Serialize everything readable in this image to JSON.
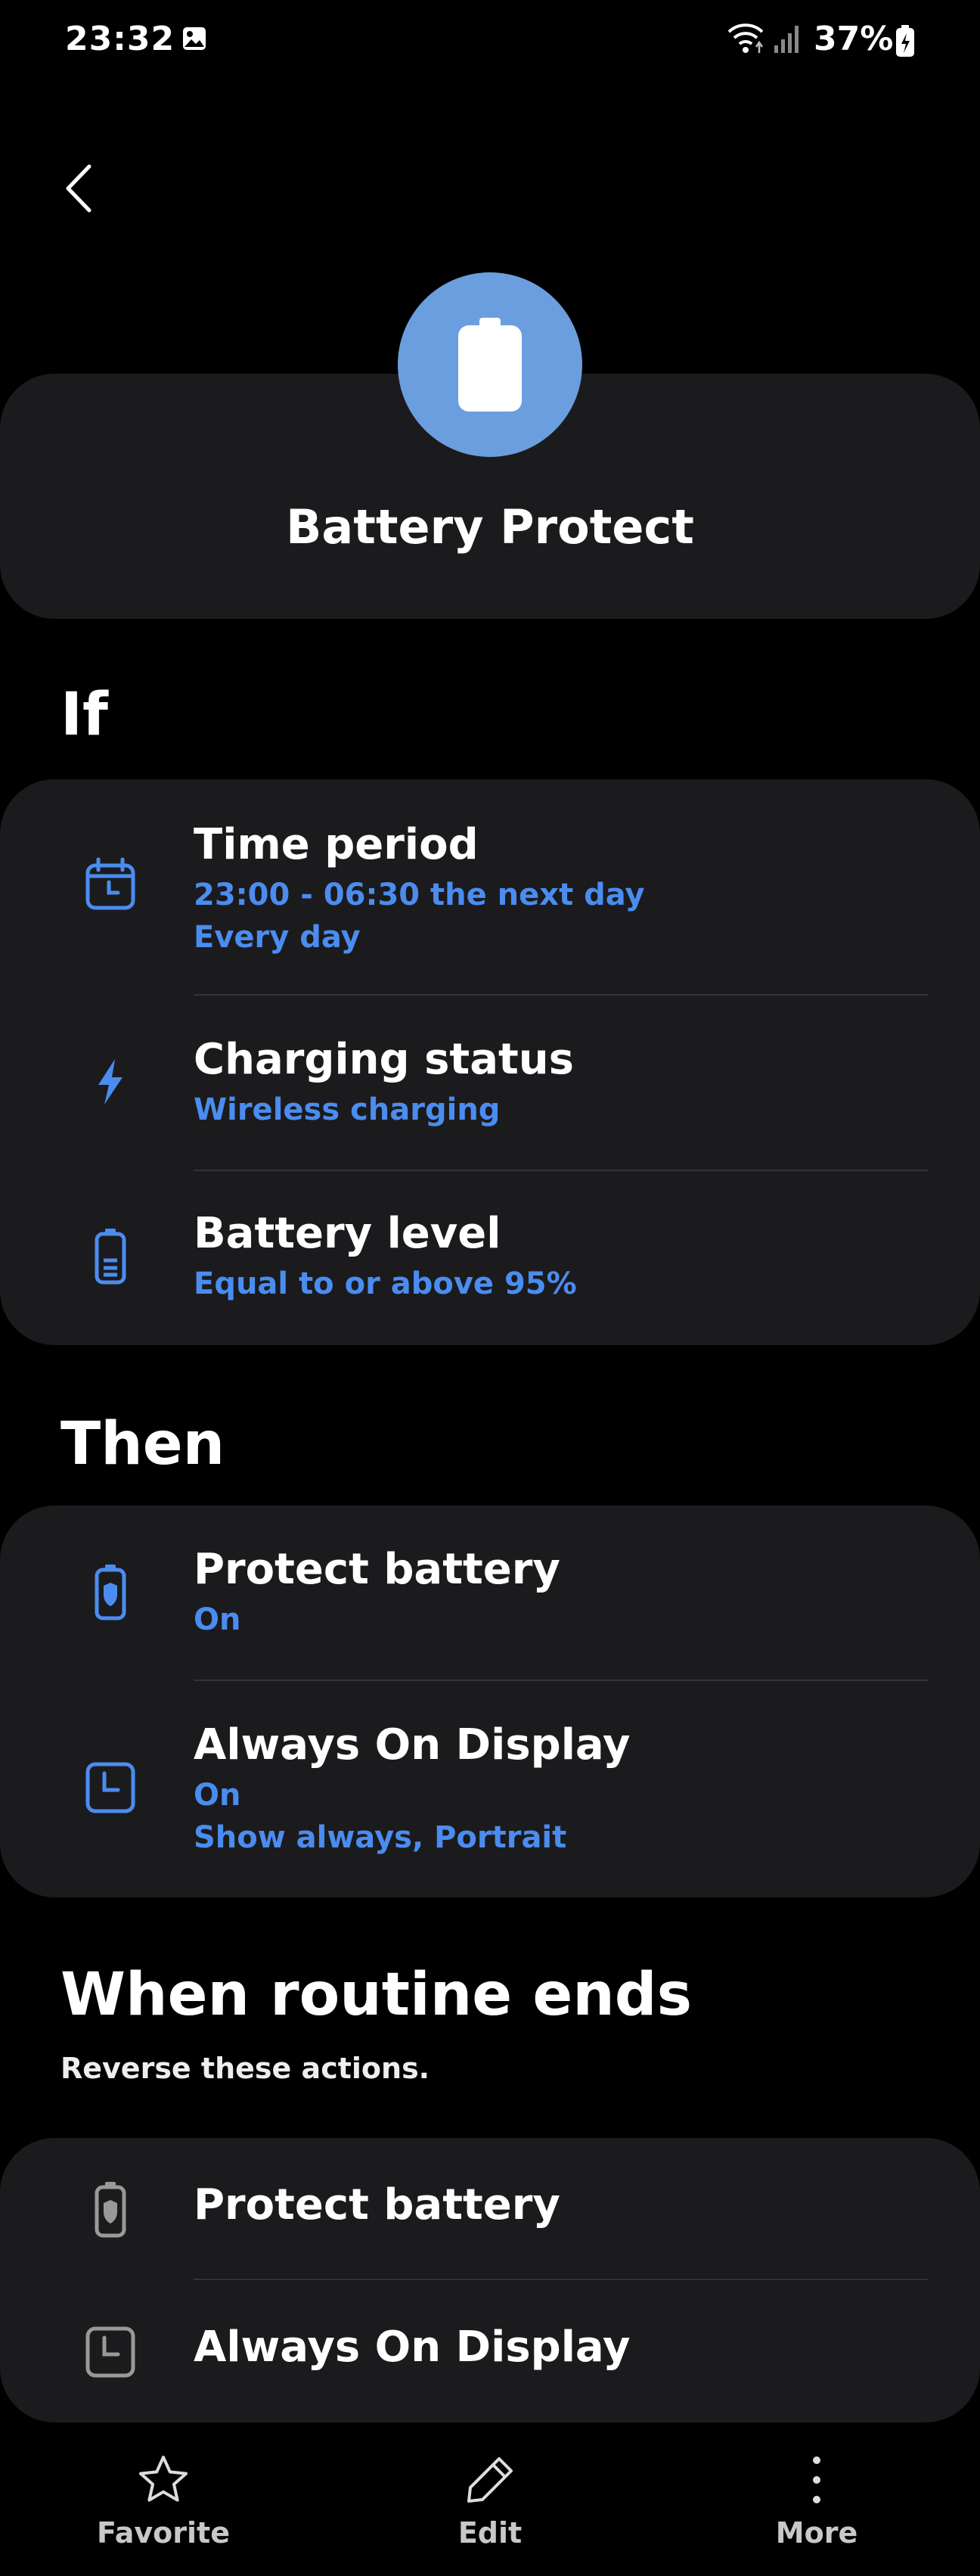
{
  "status_bar": {
    "time": "23:32",
    "battery_percent": "37%"
  },
  "header": {
    "title": "Battery Protect"
  },
  "if_section": {
    "heading": "If",
    "items": [
      {
        "title": "Time period",
        "line1": "23:00 - 06:30 the next day",
        "line2": "Every day",
        "icon": "calendar-icon"
      },
      {
        "title": "Charging status",
        "line1": "Wireless charging",
        "icon": "bolt-icon"
      },
      {
        "title": "Battery level",
        "line1": "Equal to or above 95%",
        "icon": "battery-icon"
      }
    ]
  },
  "then_section": {
    "heading": "Then",
    "items": [
      {
        "title": "Protect battery",
        "line1": "On",
        "icon": "battery-shield-icon"
      },
      {
        "title": "Always On Display",
        "line1": "On",
        "line2": "Show always, Portrait",
        "icon": "clock-screen-icon"
      }
    ]
  },
  "ends_section": {
    "heading": "When routine ends",
    "subtitle": "Reverse these actions.",
    "items": [
      {
        "title": "Protect battery",
        "icon": "battery-shield-icon"
      },
      {
        "title": "Always On Display",
        "icon": "clock-screen-icon"
      }
    ]
  },
  "bottom_nav": {
    "favorite": "Favorite",
    "edit": "Edit",
    "more": "More"
  },
  "colors": {
    "accent": "#4b8cf0",
    "hero_circle": "#6b9ede",
    "card": "#1b1b1d"
  }
}
